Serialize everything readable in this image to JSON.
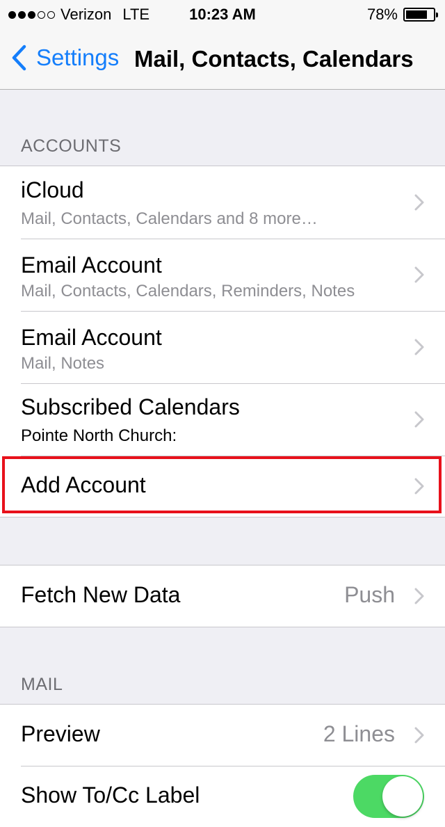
{
  "status_bar": {
    "signal_bars_filled": 3,
    "signal_bars_total": 5,
    "carrier": "Verizon",
    "network": "LTE",
    "time": "10:23 AM",
    "battery_percent": "78%",
    "battery_level": 0.78
  },
  "nav": {
    "back_label": "Settings",
    "title": "Mail, Contacts, Calendars"
  },
  "accounts_section": {
    "header": "ACCOUNTS",
    "items": [
      {
        "title": "iCloud",
        "subtitle": "Mail, Contacts, Calendars and 8 more…"
      },
      {
        "title": "Email Account",
        "subtitle": "Mail, Contacts, Calendars, Reminders, Notes"
      },
      {
        "title": "Email Account",
        "subtitle": "Mail, Notes"
      },
      {
        "title": "Subscribed Calendars",
        "subtitle": "Pointe North Church:"
      },
      {
        "title": "Add Account"
      }
    ]
  },
  "fetch": {
    "title": "Fetch New Data",
    "value": "Push"
  },
  "mail_section": {
    "header": "MAIL",
    "preview": {
      "title": "Preview",
      "value": "2 Lines"
    },
    "show_to_cc": {
      "title": "Show To/Cc Label",
      "on": true
    }
  },
  "colors": {
    "accent": "#147efb",
    "highlight_border": "#e8111b",
    "toggle_on": "#4cd964",
    "background": "#efeff4"
  }
}
